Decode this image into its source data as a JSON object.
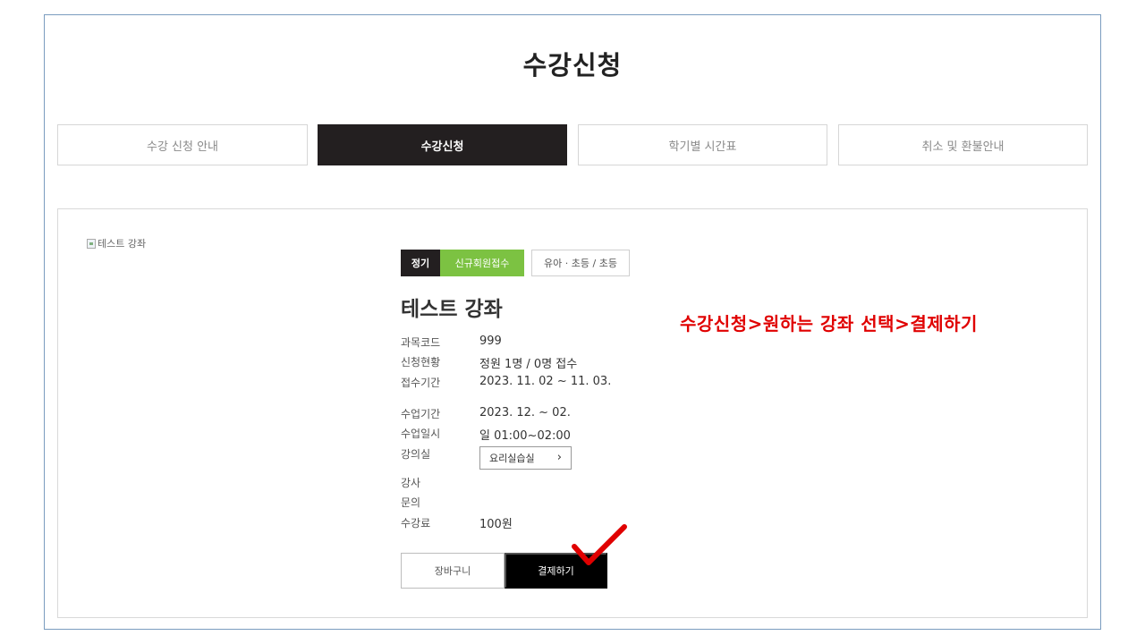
{
  "page": {
    "title": "수강신청"
  },
  "tabs": [
    {
      "label": "수강 신청 안내",
      "active": false
    },
    {
      "label": "수강신청",
      "active": true
    },
    {
      "label": "학기별 시간표",
      "active": false
    },
    {
      "label": "취소 및 환불안내",
      "active": false
    }
  ],
  "course": {
    "image_alt": "테스트 강좌",
    "badges": {
      "type": "정기",
      "status": "신규회원접수",
      "target": "유아 · 초등 / 초등"
    },
    "title": "테스트 강좌",
    "info": {
      "code": {
        "label": "과목코드",
        "value": "999"
      },
      "status": {
        "label": "신청현황",
        "value": "정원 1명 / 0명 접수"
      },
      "reg_period": {
        "label": "접수기간",
        "value": "2023. 11. 02 ~ 11. 03."
      },
      "class_period": {
        "label": "수업기간",
        "value": "2023. 12. ~ 02."
      },
      "class_time": {
        "label": "수업일시",
        "value": "일 01:00~02:00"
      },
      "room": {
        "label": "강의실",
        "value": "요리실습실"
      },
      "teacher": {
        "label": "강사",
        "value": ""
      },
      "contact": {
        "label": "문의",
        "value": ""
      },
      "fee": {
        "label": "수강료",
        "value": "100원"
      }
    },
    "buttons": {
      "cart": "장바구니",
      "pay": "결제하기"
    }
  },
  "annotation": {
    "text": "수강신청>원하는 강좌 선택>결제하기",
    "color": "#e00000"
  },
  "colors": {
    "accent_dark": "#231f20",
    "accent_green": "#7cc242",
    "frame_border": "#7a9cbf"
  }
}
